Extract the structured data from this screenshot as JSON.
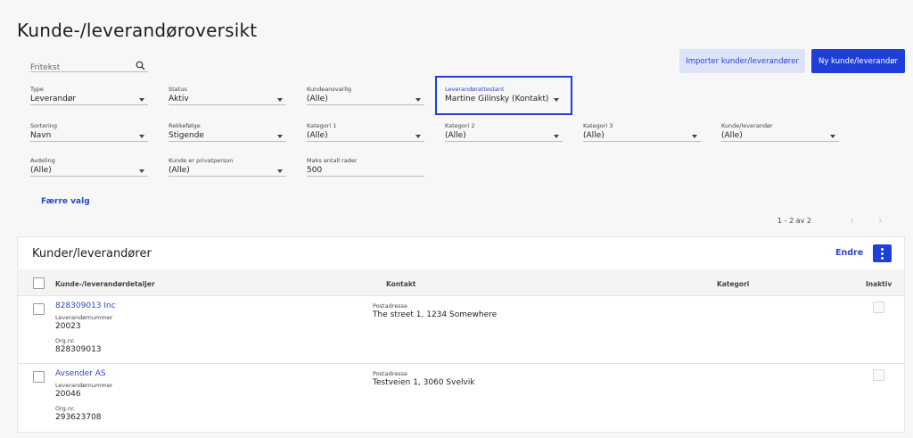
{
  "page_title": "Kunde-/leverandøroversikt",
  "search": {
    "placeholder": "Fritekst"
  },
  "buttons": {
    "import": "Importer kunder/leverandører",
    "new": "Ny kunde/leverandør"
  },
  "filters": {
    "type": {
      "label": "Type",
      "value": "Leverandør"
    },
    "status": {
      "label": "Status",
      "value": "Aktiv"
    },
    "kundeansvarlig": {
      "label": "Kundeansvarlig",
      "value": "(Alle)"
    },
    "leverandorattestant": {
      "label": "Leverandørattestant",
      "value": "Martine Gilinsky (Kontakt)"
    },
    "sortering": {
      "label": "Sortering",
      "value": "Navn"
    },
    "rekkefolge": {
      "label": "Rekkefølge",
      "value": "Stigende"
    },
    "kategori1": {
      "label": "Kategori 1",
      "value": "(Alle)"
    },
    "kategori2": {
      "label": "Kategori 2",
      "value": "(Alle)"
    },
    "kategori3": {
      "label": "Kategori 3",
      "value": "(Alle)"
    },
    "kundeleverandor": {
      "label": "Kunde/leverandør",
      "value": "(Alle)"
    },
    "avdeling": {
      "label": "Avdeling",
      "value": "(Alle)"
    },
    "kundeprivat": {
      "label": "Kunde er privatperson",
      "value": "(Alle)"
    },
    "maksrader": {
      "label": "Maks antall rader",
      "value": "500"
    }
  },
  "fewer_options": "Færre valg",
  "pager": {
    "text": "1 - 2 av 2",
    "prev": "‹",
    "next": "›"
  },
  "panel": {
    "title": "Kunder/leverandører",
    "edit": "Endre",
    "columns": {
      "details": "Kunde-/leverandørdetaljer",
      "contact": "Kontakt",
      "category": "Kategori",
      "inactive": "Inaktiv"
    },
    "rows": [
      {
        "name": "828309013 Inc",
        "num_label": "Leverandørnummer",
        "num": "20023",
        "org_label": "Org.nr.",
        "org": "828309013",
        "addr_label": "Postadresse",
        "addr": "The street 1, 1234 Somewhere"
      },
      {
        "name": "Avsender AS",
        "num_label": "Leverandørnummer",
        "num": "20046",
        "org_label": "Org.nr.",
        "org": "293623708",
        "addr_label": "Postadresse",
        "addr": "Testveien 1, 3060 Svelvik"
      }
    ]
  },
  "colors": {
    "accent": "#1f3fd9",
    "link": "#2b47c9",
    "background": "#f7f7f8"
  },
  "icons": {
    "search": "search-icon",
    "caret": "chevron-down-icon",
    "more": "more-vertical-icon"
  }
}
